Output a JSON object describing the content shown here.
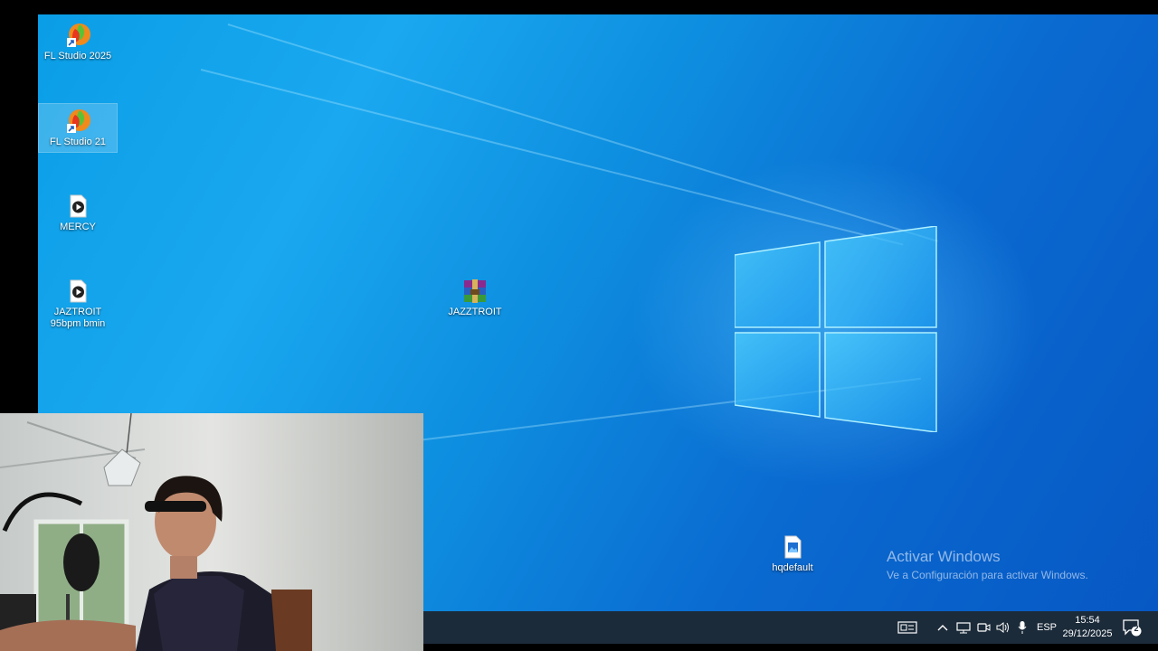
{
  "desktop": {
    "icons": [
      {
        "label": "FL Studio 2025",
        "icon": "fl-studio-icon"
      },
      {
        "label": "FL Studio 21",
        "icon": "fl-studio-icon"
      },
      {
        "label": "MERCY",
        "icon": "audio-file-icon"
      },
      {
        "label": "JAZTROIT 95bpm bmin",
        "icon": "audio-file-icon"
      },
      {
        "label": "JAZZTROIT",
        "icon": "winrar-archive-icon"
      },
      {
        "label": "hqdefault",
        "icon": "image-file-icon"
      }
    ],
    "activate_title": "Activar Windows",
    "activate_subtitle": "Ve a Configuración para activar Windows."
  },
  "taskbar": {
    "language": "ESP",
    "time": "15:54",
    "date": "29/12/2025",
    "notification_count": "2",
    "tray_icons": [
      "news-widget-icon",
      "chevron-up-icon",
      "network-icon",
      "meet-now-icon",
      "volume-icon",
      "microphone-icon"
    ]
  },
  "colors": {
    "desktop_blue": "#0a9ee6",
    "taskbar": "#1c2b3a"
  }
}
